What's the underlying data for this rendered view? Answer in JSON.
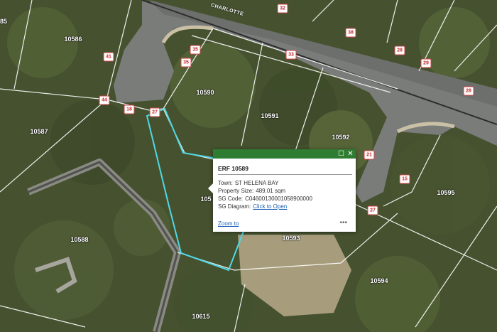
{
  "street_name": "CHARLOTTE",
  "erf_labels": [
    {
      "id": "erf-10585",
      "text": "85"
    },
    {
      "id": "erf-10586",
      "text": "10586"
    },
    {
      "id": "erf-10587",
      "text": "10587"
    },
    {
      "id": "erf-10588",
      "text": "10588"
    },
    {
      "id": "erf-10589",
      "text": "105"
    },
    {
      "id": "erf-10590",
      "text": "10590"
    },
    {
      "id": "erf-10591",
      "text": "10591"
    },
    {
      "id": "erf-10592",
      "text": "10592"
    },
    {
      "id": "erf-10593",
      "text": "10593"
    },
    {
      "id": "erf-10594",
      "text": "10594"
    },
    {
      "id": "erf-10595",
      "text": "10595"
    },
    {
      "id": "erf-10615",
      "text": "10615"
    }
  ],
  "dimension_labels": [
    "32",
    "38",
    "41",
    "35",
    "35",
    "27",
    "44",
    "18",
    "33",
    "28",
    "29",
    "28",
    "21",
    "15",
    "27"
  ],
  "popup": {
    "title": "ERF 10589",
    "fields": [
      {
        "label": "Town:",
        "value": "ST HELENA BAY"
      },
      {
        "label": "Property Size:",
        "value": "489.01 sqm"
      },
      {
        "label": "SG Code:",
        "value": "C04600130001058900000"
      },
      {
        "label": "SG Diagram:",
        "value": "Click to Open"
      }
    ],
    "zoom_label": "Zoom to",
    "more_label": "•••",
    "maximize_icon": "☐",
    "close_icon": "✕"
  },
  "colors": {
    "highlight": "#4fd8e6",
    "header": "#2f7d32",
    "parcel_line": "#ffffff"
  }
}
